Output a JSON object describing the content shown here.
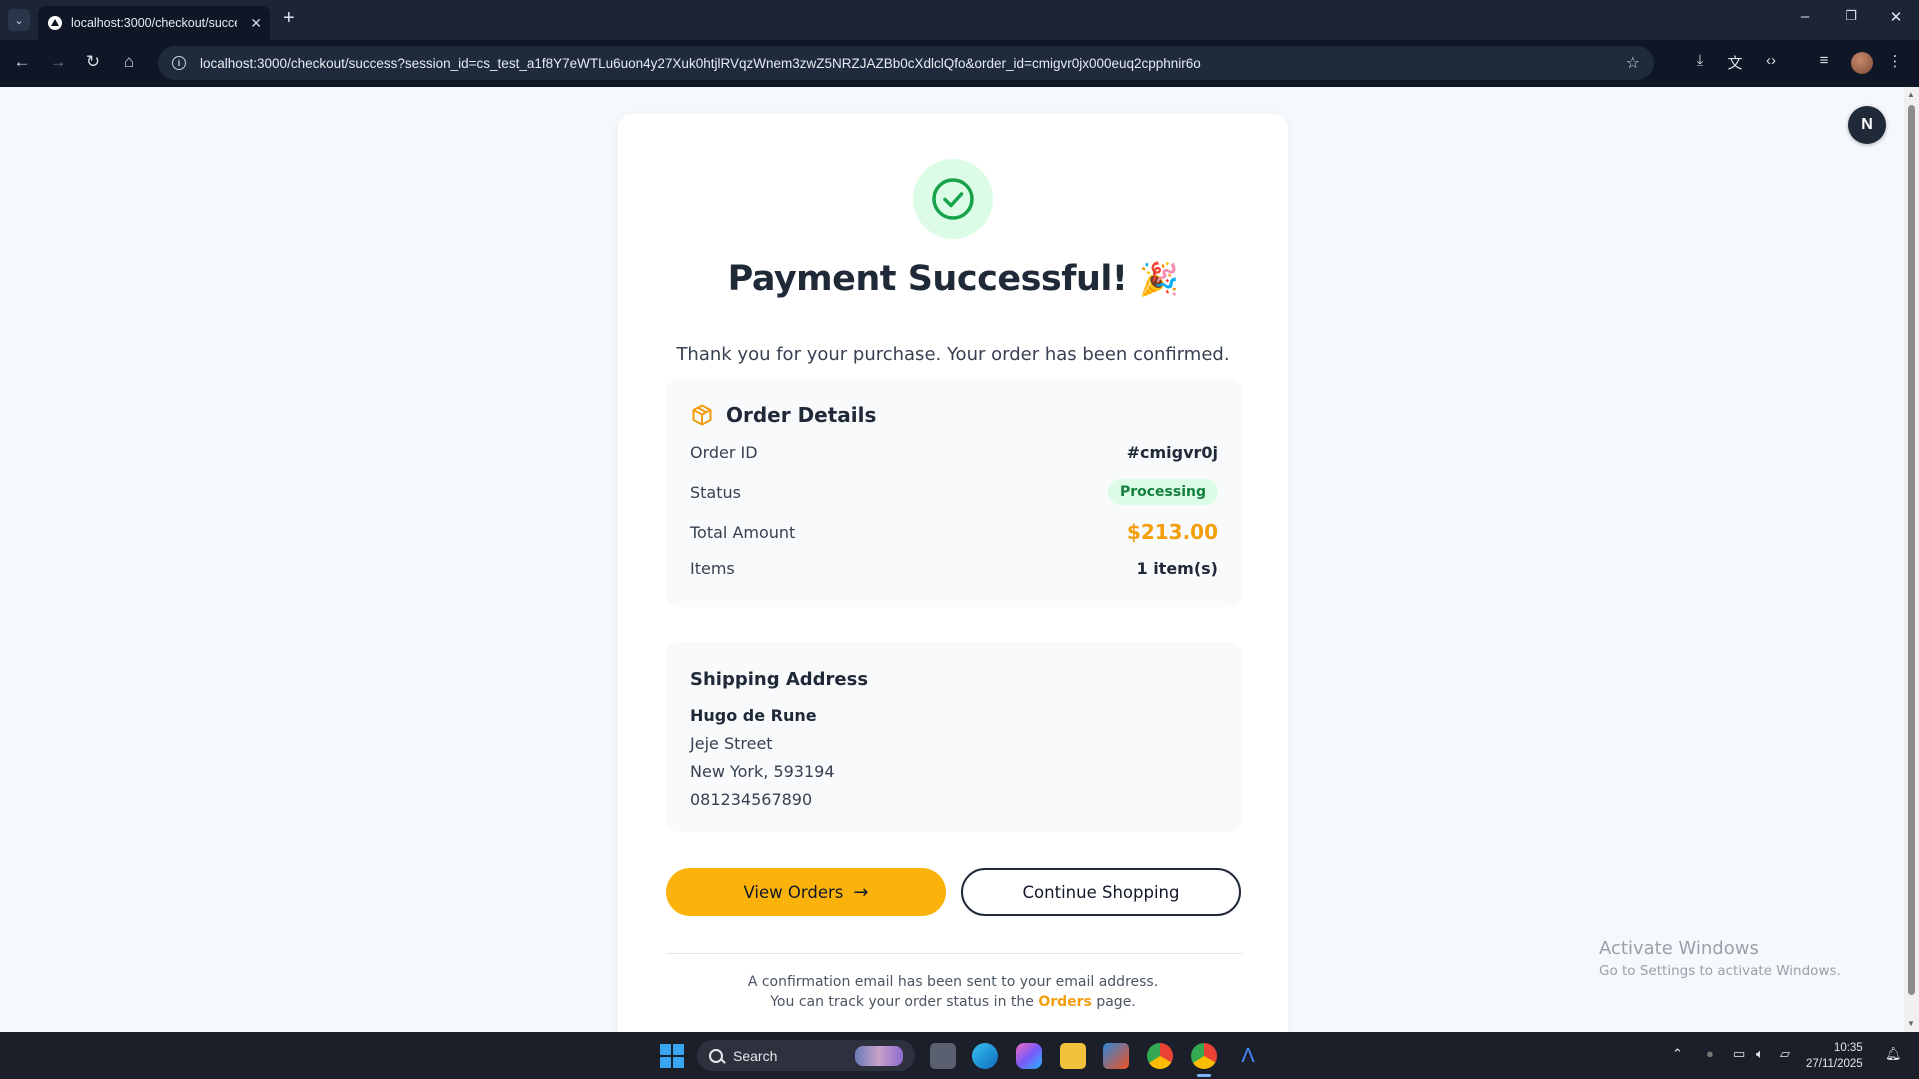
{
  "browser": {
    "tab_title": "localhost:3000/checkout/success",
    "url": "localhost:3000/checkout/success?session_id=cs_test_a1f8Y7eWTLu6uon4y27Xuk0htjlRVqzWnem3zwZ5NRZJAZBb0cXdlclQfo&order_id=cmigvr0jx000euq2cpphnir6o"
  },
  "success": {
    "title": "Payment Successful!",
    "emoji": "🎉",
    "subtitle": "Thank you for your purchase. Your order has been confirmed."
  },
  "order_details": {
    "heading": "Order Details",
    "rows": [
      {
        "label": "Order ID",
        "value": "#cmigvr0j"
      },
      {
        "label": "Status",
        "value": "Processing"
      },
      {
        "label": "Total Amount",
        "value": "$213.00"
      },
      {
        "label": "Items",
        "value": "1 item(s)"
      }
    ]
  },
  "shipping": {
    "heading": "Shipping Address",
    "name": "Hugo de Rune",
    "street": "Jeje Street",
    "city": "New York, 593194",
    "phone": "081234567890"
  },
  "actions": {
    "view_orders": "View Orders",
    "continue_shopping": "Continue Shopping"
  },
  "footer": {
    "line1": "A confirmation email has been sent to your email address.",
    "line2_prefix": "You can track your order status in the",
    "line2_link": "Orders",
    "line2_suffix": "page."
  },
  "user": {
    "avatar_initial": "N"
  },
  "watermark": {
    "title": "Activate Windows",
    "subtitle": "Go to Settings to activate Windows."
  },
  "taskbar": {
    "search_placeholder": "Search",
    "time": "10:35",
    "date": "27/11/2025"
  },
  "colors": {
    "accent": "#fbb20b",
    "success_green": "#16a34a",
    "amount": "#f59e0b"
  }
}
